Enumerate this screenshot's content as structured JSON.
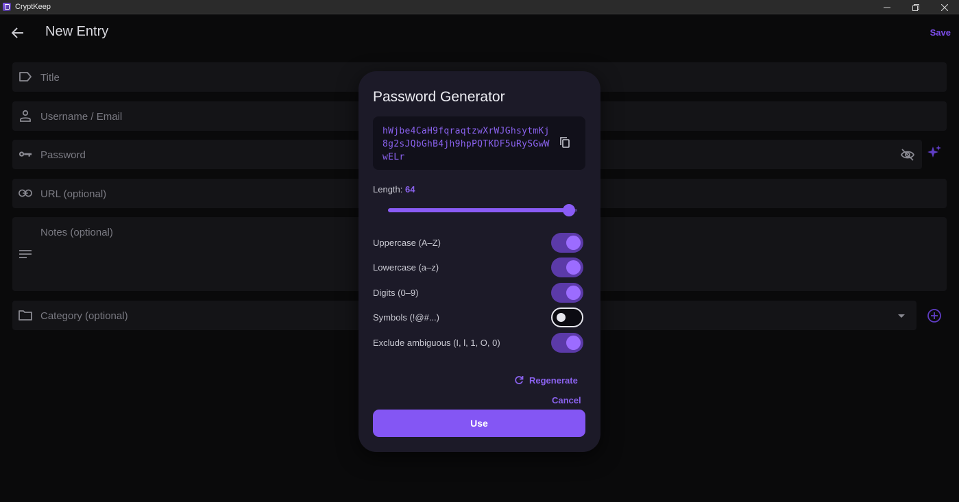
{
  "window": {
    "title": "CryptKeep"
  },
  "appbar": {
    "title": "New Entry",
    "save_label": "Save"
  },
  "fields": {
    "title": "Title",
    "username": "Username / Email",
    "password": "Password",
    "url": "URL (optional)",
    "notes": "Notes (optional)",
    "category": "Category (optional)"
  },
  "dialog": {
    "title": "Password Generator",
    "password": "hWjbe4CaH9fqraqtzwXrWJGhsytmKj8g2sJQbGhB4jh9hpPQTKDF5uRySGwWwELr",
    "length_label": "Length: ",
    "length_value": "64",
    "slider_fraction": 1.0,
    "options": [
      {
        "label": "Uppercase (A–Z)",
        "enabled": true
      },
      {
        "label": "Lowercase (a–z)",
        "enabled": true
      },
      {
        "label": "Digits (0–9)",
        "enabled": true
      },
      {
        "label": "Symbols (!@#...)",
        "enabled": false
      },
      {
        "label": "Exclude ambiguous (I, l, 1, O, 0)",
        "enabled": true
      }
    ],
    "regenerate_label": "Regenerate",
    "cancel_label": "Cancel",
    "use_label": "Use"
  },
  "colors": {
    "accent": "#8456f4",
    "background": "#0a0a0b",
    "dialog": "#1c1a28",
    "field": "#141417"
  },
  "icons": [
    "back-arrow-icon",
    "tag-icon",
    "person-icon",
    "key-icon",
    "link-icon",
    "notes-icon",
    "folder-icon",
    "eye-off-icon",
    "sparkle-icon",
    "chevron-down-icon",
    "add-circle-icon",
    "copy-icon",
    "refresh-icon",
    "minimize-icon",
    "restore-icon",
    "close-icon"
  ]
}
